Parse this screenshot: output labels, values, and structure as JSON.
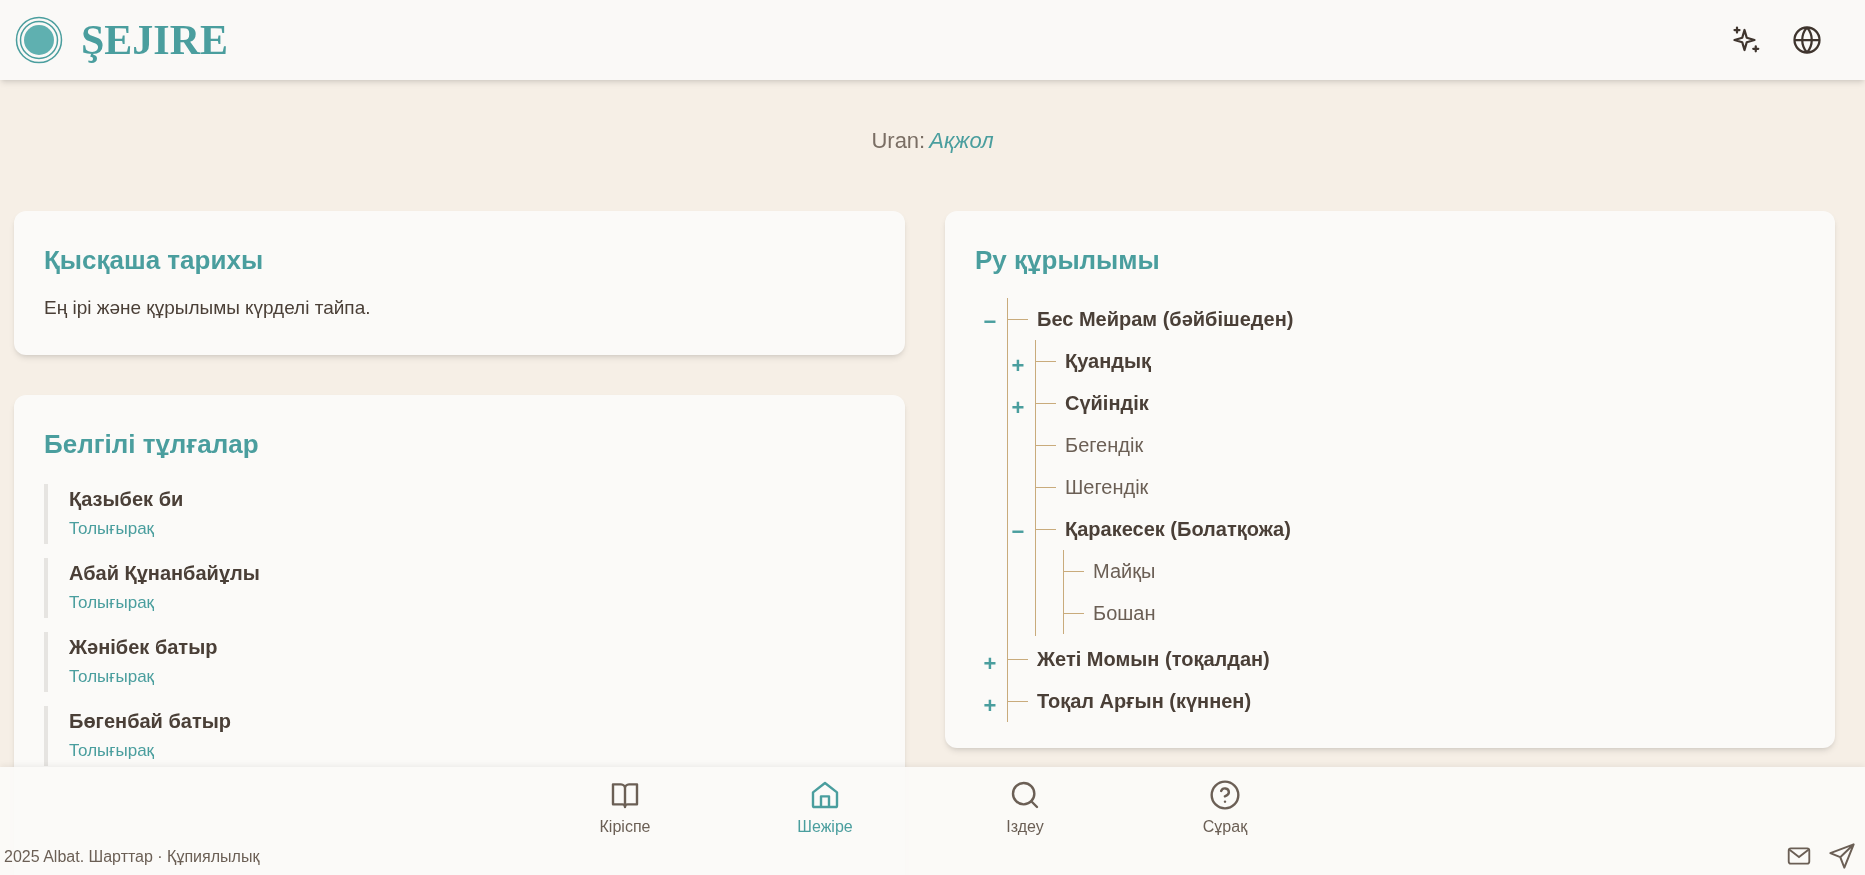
{
  "header": {
    "logo_text": "ŞEJIRE"
  },
  "uran": {
    "label": "Uran:",
    "value": "Ақжол"
  },
  "history": {
    "heading": "Қысқаша тарихы",
    "text": "Ең ірі және құрылымы күрделі тайпа."
  },
  "people": {
    "heading": "Белгілі тұлғалар",
    "items": [
      {
        "name": "Қазыбек би",
        "link": "Толығырақ"
      },
      {
        "name": "Абай Құнанбайұлы",
        "link": "Толығырақ"
      },
      {
        "name": "Жәнібек батыр",
        "link": "Толығырақ"
      },
      {
        "name": "Бөгенбай батыр",
        "link": "Толығырақ"
      }
    ]
  },
  "structure": {
    "heading": "Ру құрылымы",
    "tree": [
      {
        "kind": "branch",
        "label": "Бес Мейрам (бәйбішеден)",
        "toggle": "−",
        "expanded": true,
        "children": [
          {
            "kind": "branch",
            "label": "Қуандық",
            "toggle": "+",
            "expanded": false
          },
          {
            "kind": "branch",
            "label": "Сүйіндік",
            "toggle": "+",
            "expanded": false
          },
          {
            "kind": "leaf",
            "label": "Бегендік"
          },
          {
            "kind": "leaf",
            "label": "Шегендік"
          },
          {
            "kind": "branch",
            "label": "Қаракесек (Болатқожа)",
            "toggle": "−",
            "expanded": true,
            "children": [
              {
                "kind": "leaf",
                "label": "Майқы"
              },
              {
                "kind": "leaf",
                "label": "Бошан"
              }
            ]
          }
        ]
      },
      {
        "kind": "branch",
        "label": "Жеті Момын (тоқалдан)",
        "toggle": "+",
        "expanded": false
      },
      {
        "kind": "branch",
        "label": "Тоқал Арғын (күннен)",
        "toggle": "+",
        "expanded": false
      }
    ]
  },
  "nav": [
    {
      "label": "Кіріспе",
      "selected": false
    },
    {
      "label": "Шежіре",
      "selected": true
    },
    {
      "label": "Іздеу",
      "selected": false
    },
    {
      "label": "Сұрақ",
      "selected": false
    }
  ],
  "footer": {
    "text": "2025 Albat. Шарттар · Құпиялылық"
  }
}
